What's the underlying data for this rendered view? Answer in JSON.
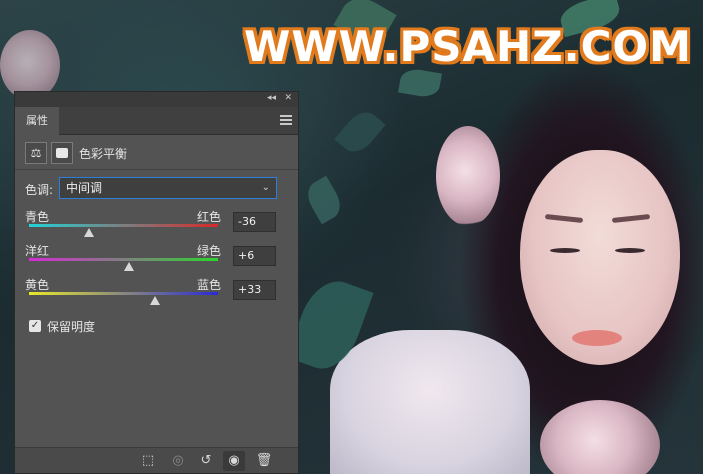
{
  "watermark": "WWW.PSAHZ.COM",
  "panel": {
    "tab_label": "属性",
    "collapse_glyph": "◂◂",
    "close_glyph": "✕",
    "adjustment_title": "色彩平衡",
    "tone": {
      "label": "色调:",
      "selected": "中间调"
    },
    "sliders": [
      {
        "left_label": "青色",
        "right_label": "红色",
        "value": "-36",
        "numeric": -36,
        "colors": [
          "#22d3d6",
          "#d62a2a"
        ]
      },
      {
        "left_label": "洋红",
        "right_label": "绿色",
        "value": "+6",
        "numeric": 6,
        "colors": [
          "#d62ad6",
          "#2ad62a"
        ]
      },
      {
        "left_label": "黄色",
        "right_label": "蓝色",
        "value": "+33",
        "numeric": 33,
        "colors": [
          "#e8e82a",
          "#2a2ad6"
        ]
      }
    ],
    "preserve_luminosity": {
      "label": "保留明度",
      "checked": true
    },
    "footer_icons": [
      "clip-to-layer-icon",
      "view-previous-state-icon",
      "reset-icon",
      "visibility-eye-icon",
      "trash-icon"
    ]
  },
  "colors": {
    "panel_bg": "#535353",
    "accent_focus": "#2a7fd6",
    "watermark_stroke": "#e07a1c"
  }
}
